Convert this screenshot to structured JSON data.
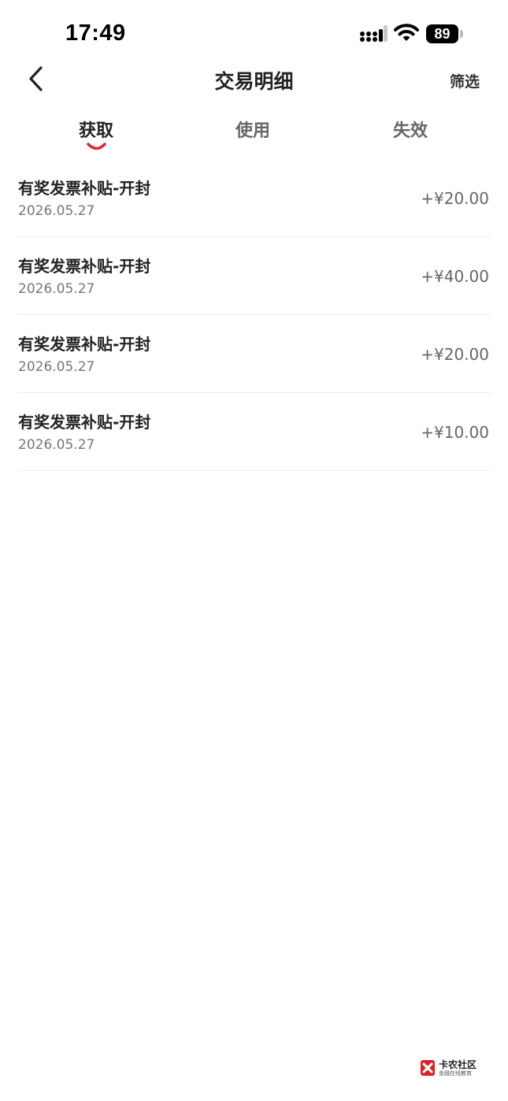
{
  "status_bar": {
    "time": "17:49",
    "battery": "89",
    "icons": [
      "signal-icon",
      "wifi-icon",
      "battery-icon"
    ]
  },
  "header": {
    "back_icon": "chevron-left-icon",
    "title": "交易明细",
    "filter_label": "筛选"
  },
  "tabs": [
    {
      "label": "获取",
      "active": true
    },
    {
      "label": "使用",
      "active": false
    },
    {
      "label": "失效",
      "active": false
    }
  ],
  "transactions": [
    {
      "title": "有奖发票补贴-开封",
      "date": "2026.05.27",
      "amount": "+¥20.00"
    },
    {
      "title": "有奖发票补贴-开封",
      "date": "2026.05.27",
      "amount": "+¥40.00"
    },
    {
      "title": "有奖发票补贴-开封",
      "date": "2026.05.27",
      "amount": "+¥20.00"
    },
    {
      "title": "有奖发票补贴-开封",
      "date": "2026.05.27",
      "amount": "+¥10.00"
    }
  ],
  "watermark": {
    "title": "卡农社区",
    "subtitle": "金融在线教育"
  },
  "colors": {
    "accent": "#e0262b",
    "text_primary": "#222222",
    "text_secondary": "#777777",
    "divider": "#ececec"
  }
}
